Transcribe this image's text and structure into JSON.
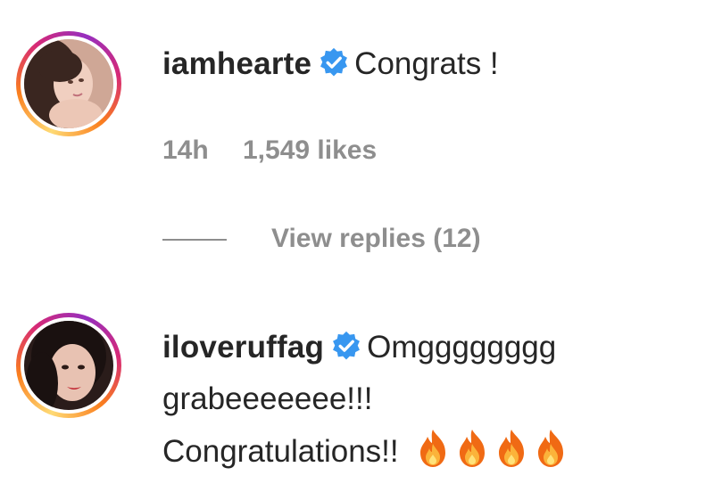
{
  "comments": [
    {
      "username": "iamhearte",
      "verified": true,
      "text": "Congrats !",
      "time": "14h",
      "likes": "1,549 likes",
      "view_replies": "View replies (12)"
    },
    {
      "username": "iloveruffag",
      "verified": true,
      "text_line1": "Omgggggggg",
      "text_line2": "grabeeeeeee!!!",
      "text_line3": "Congratulations!!",
      "emoji_count": 4,
      "emoji": "fire-icon"
    }
  ],
  "colors": {
    "verified_blue": "#3897f0",
    "muted_text": "#8e8e8e",
    "primary_text": "#262626"
  }
}
